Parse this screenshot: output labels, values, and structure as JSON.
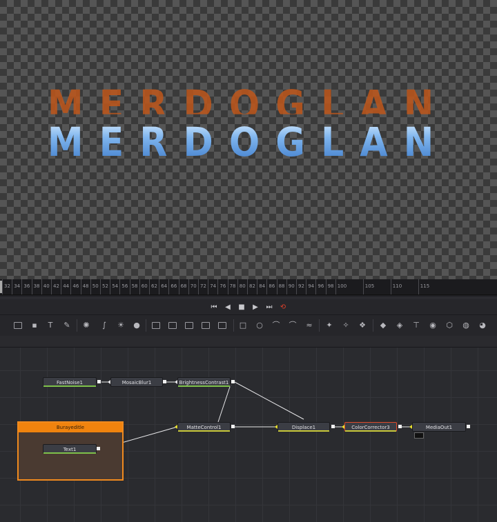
{
  "viewer": {
    "text": "MERDOGLAN",
    "ghost_text": "MERDOGLAN"
  },
  "ruler": {
    "ticks": [
      "32",
      "34",
      "36",
      "38",
      "40",
      "42",
      "44",
      "46",
      "48",
      "50",
      "52",
      "54",
      "56",
      "58",
      "60",
      "62",
      "64",
      "66",
      "68",
      "70",
      "72",
      "74",
      "76",
      "78",
      "80",
      "82",
      "84",
      "86",
      "88",
      "90",
      "92",
      "94",
      "96",
      "98",
      "100",
      "105",
      "110",
      "115"
    ]
  },
  "transport": {
    "first": "⏮",
    "prev": "◀",
    "stop": "■",
    "play": "▶",
    "last": "⏭",
    "loop": "⟲"
  },
  "toolbar": {
    "icons": [
      "background-icon",
      "paint-icon",
      "text-icon",
      "brush-icon",
      "particle-icon",
      "curve-icon",
      "bc-icon",
      "drop-icon",
      "merge-icon",
      "channel-icon",
      "time-icon",
      "matte-icon",
      "media-icon",
      "rect-icon",
      "circle-icon",
      "polygon-icon",
      "bspline-icon",
      "emitter-icon",
      "render-icon",
      "3d-shape-icon",
      "3d-merge-icon",
      "3d-camera-icon",
      "3d-light-icon",
      "3d-render-icon",
      "3d-text-icon",
      "3d-image-icon"
    ]
  },
  "flow": {
    "group_title": "Burayeditle",
    "nodes": {
      "fastnoise": "FastNoise1",
      "mosaicblur": "MosaicBlur1",
      "brightness": "BrightnessContrast1",
      "text": "Text1",
      "mattecontrol": "MatteControl1",
      "displace": "Displace1",
      "colorcorrector": "ColorCorrector3",
      "mediaout": "MediaOut1"
    }
  },
  "colors": {
    "accent": "#f0830e",
    "selected": "#e04a2a",
    "loop": "#e0402a",
    "noise_line": "#7fc24a",
    "matte_line": "#c9c93a"
  }
}
